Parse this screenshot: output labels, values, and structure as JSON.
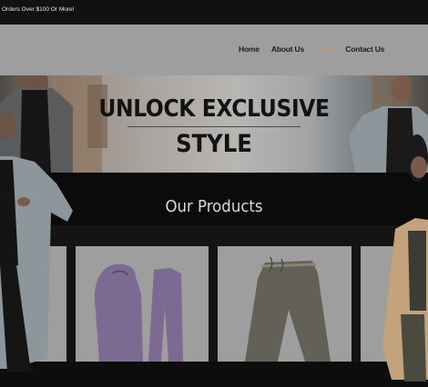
{
  "promo": {
    "text": "Orders Over $100 Or More!"
  },
  "nav": {
    "items": [
      {
        "label": "Home",
        "active": false
      },
      {
        "label": "About Us",
        "active": false
      },
      {
        "label": "Store",
        "active": true
      },
      {
        "label": "Contact Us",
        "active": false
      }
    ],
    "active_color": "#c98e6a"
  },
  "hero": {
    "title_line1": "UNLOCK EXCLUSIVE",
    "title_line2": "STYLE"
  },
  "products": {
    "heading": "Our Products",
    "items": [
      {
        "image": "partial-product-image"
      },
      {
        "image": "purple-hoodie-and-pants-image",
        "color": "#7d6a92"
      },
      {
        "image": "olive-sweatpants-image",
        "color": "#626057"
      },
      {
        "image": "partial-product-image"
      }
    ]
  },
  "colors": {
    "header_bg": "#9e9e9e",
    "page_bg": "#0b0b0b",
    "card_bg": "#9e9e9e"
  }
}
